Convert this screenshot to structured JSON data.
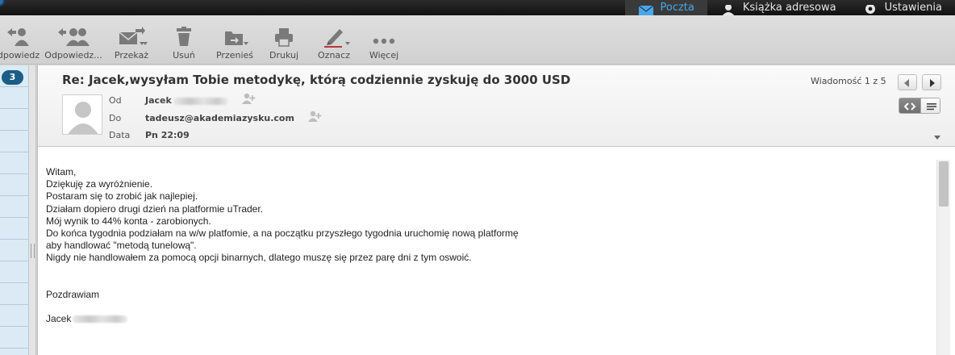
{
  "topnav": {
    "items": [
      {
        "label": "Poczta",
        "icon": "envelope-icon",
        "active": true
      },
      {
        "label": "Książka adresowa",
        "icon": "person-icon",
        "active": false
      },
      {
        "label": "Ustawienia",
        "icon": "gear-icon",
        "active": false
      }
    ]
  },
  "toolbar": {
    "reply": "dpowiedz",
    "reply_all": "Odpowiedz...",
    "forward": "Przekaż",
    "delete": "Usuń",
    "move": "Przenieś",
    "print": "Drukuj",
    "mark": "Oznacz",
    "more": "Więcej"
  },
  "folders": {
    "unread_badge": "3"
  },
  "message": {
    "subject": "Re: Jacek,wysyłam Tobie metodykę, którą codziennie zyskuję do 3000 USD",
    "from_label": "Od",
    "from_name": "Jacek",
    "to_label": "Do",
    "to_address": "tadeusz@akademiazysku.com",
    "date_label": "Data",
    "date_value": "Pn 22:09",
    "counter": "Wiadomość 1 z 5",
    "body_lines": [
      "Witam,",
      "Dziękuję za wyróżnienie.",
      "Postaram się to zrobić jak najlepiej.",
      "Działam dopiero drugi dzień na platformie uTrader.",
      "Mój wynik to 44% konta - zarobionych.",
      "Do końca tygodnia podziałam na w/w platfomie, a na początku przyszłego tygodnia uruchomię nową platformę",
      "aby handlować \"metodą tunelową\".",
      "Nigdy nie handlowałem za pomocą opcji binarnych, dlatego muszę się przez parę dni z tym oswoić."
    ],
    "closing": "Pozdrawiam",
    "signature": "Jacek"
  },
  "colors": {
    "accent": "#4aa6e8",
    "badge": "#1b5d86",
    "topbar": "#1a1a1a"
  }
}
